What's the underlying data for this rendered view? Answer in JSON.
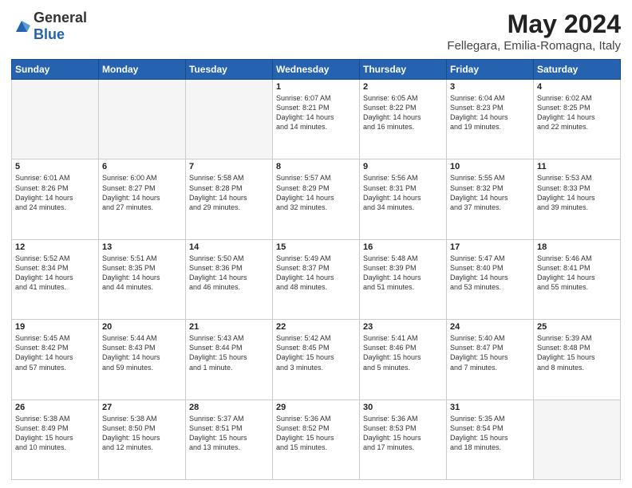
{
  "header": {
    "logo": {
      "general": "General",
      "blue": "Blue"
    },
    "title": "May 2024",
    "subtitle": "Fellegara, Emilia-Romagna, Italy"
  },
  "calendar": {
    "weekdays": [
      "Sunday",
      "Monday",
      "Tuesday",
      "Wednesday",
      "Thursday",
      "Friday",
      "Saturday"
    ],
    "weeks": [
      [
        {
          "day": "",
          "info": ""
        },
        {
          "day": "",
          "info": ""
        },
        {
          "day": "",
          "info": ""
        },
        {
          "day": "1",
          "info": "Sunrise: 6:07 AM\nSunset: 8:21 PM\nDaylight: 14 hours\nand 14 minutes."
        },
        {
          "day": "2",
          "info": "Sunrise: 6:05 AM\nSunset: 8:22 PM\nDaylight: 14 hours\nand 16 minutes."
        },
        {
          "day": "3",
          "info": "Sunrise: 6:04 AM\nSunset: 8:23 PM\nDaylight: 14 hours\nand 19 minutes."
        },
        {
          "day": "4",
          "info": "Sunrise: 6:02 AM\nSunset: 8:25 PM\nDaylight: 14 hours\nand 22 minutes."
        }
      ],
      [
        {
          "day": "5",
          "info": "Sunrise: 6:01 AM\nSunset: 8:26 PM\nDaylight: 14 hours\nand 24 minutes."
        },
        {
          "day": "6",
          "info": "Sunrise: 6:00 AM\nSunset: 8:27 PM\nDaylight: 14 hours\nand 27 minutes."
        },
        {
          "day": "7",
          "info": "Sunrise: 5:58 AM\nSunset: 8:28 PM\nDaylight: 14 hours\nand 29 minutes."
        },
        {
          "day": "8",
          "info": "Sunrise: 5:57 AM\nSunset: 8:29 PM\nDaylight: 14 hours\nand 32 minutes."
        },
        {
          "day": "9",
          "info": "Sunrise: 5:56 AM\nSunset: 8:31 PM\nDaylight: 14 hours\nand 34 minutes."
        },
        {
          "day": "10",
          "info": "Sunrise: 5:55 AM\nSunset: 8:32 PM\nDaylight: 14 hours\nand 37 minutes."
        },
        {
          "day": "11",
          "info": "Sunrise: 5:53 AM\nSunset: 8:33 PM\nDaylight: 14 hours\nand 39 minutes."
        }
      ],
      [
        {
          "day": "12",
          "info": "Sunrise: 5:52 AM\nSunset: 8:34 PM\nDaylight: 14 hours\nand 41 minutes."
        },
        {
          "day": "13",
          "info": "Sunrise: 5:51 AM\nSunset: 8:35 PM\nDaylight: 14 hours\nand 44 minutes."
        },
        {
          "day": "14",
          "info": "Sunrise: 5:50 AM\nSunset: 8:36 PM\nDaylight: 14 hours\nand 46 minutes."
        },
        {
          "day": "15",
          "info": "Sunrise: 5:49 AM\nSunset: 8:37 PM\nDaylight: 14 hours\nand 48 minutes."
        },
        {
          "day": "16",
          "info": "Sunrise: 5:48 AM\nSunset: 8:39 PM\nDaylight: 14 hours\nand 51 minutes."
        },
        {
          "day": "17",
          "info": "Sunrise: 5:47 AM\nSunset: 8:40 PM\nDaylight: 14 hours\nand 53 minutes."
        },
        {
          "day": "18",
          "info": "Sunrise: 5:46 AM\nSunset: 8:41 PM\nDaylight: 14 hours\nand 55 minutes."
        }
      ],
      [
        {
          "day": "19",
          "info": "Sunrise: 5:45 AM\nSunset: 8:42 PM\nDaylight: 14 hours\nand 57 minutes."
        },
        {
          "day": "20",
          "info": "Sunrise: 5:44 AM\nSunset: 8:43 PM\nDaylight: 14 hours\nand 59 minutes."
        },
        {
          "day": "21",
          "info": "Sunrise: 5:43 AM\nSunset: 8:44 PM\nDaylight: 15 hours\nand 1 minute."
        },
        {
          "day": "22",
          "info": "Sunrise: 5:42 AM\nSunset: 8:45 PM\nDaylight: 15 hours\nand 3 minutes."
        },
        {
          "day": "23",
          "info": "Sunrise: 5:41 AM\nSunset: 8:46 PM\nDaylight: 15 hours\nand 5 minutes."
        },
        {
          "day": "24",
          "info": "Sunrise: 5:40 AM\nSunset: 8:47 PM\nDaylight: 15 hours\nand 7 minutes."
        },
        {
          "day": "25",
          "info": "Sunrise: 5:39 AM\nSunset: 8:48 PM\nDaylight: 15 hours\nand 8 minutes."
        }
      ],
      [
        {
          "day": "26",
          "info": "Sunrise: 5:38 AM\nSunset: 8:49 PM\nDaylight: 15 hours\nand 10 minutes."
        },
        {
          "day": "27",
          "info": "Sunrise: 5:38 AM\nSunset: 8:50 PM\nDaylight: 15 hours\nand 12 minutes."
        },
        {
          "day": "28",
          "info": "Sunrise: 5:37 AM\nSunset: 8:51 PM\nDaylight: 15 hours\nand 13 minutes."
        },
        {
          "day": "29",
          "info": "Sunrise: 5:36 AM\nSunset: 8:52 PM\nDaylight: 15 hours\nand 15 minutes."
        },
        {
          "day": "30",
          "info": "Sunrise: 5:36 AM\nSunset: 8:53 PM\nDaylight: 15 hours\nand 17 minutes."
        },
        {
          "day": "31",
          "info": "Sunrise: 5:35 AM\nSunset: 8:54 PM\nDaylight: 15 hours\nand 18 minutes."
        },
        {
          "day": "",
          "info": ""
        }
      ]
    ]
  }
}
